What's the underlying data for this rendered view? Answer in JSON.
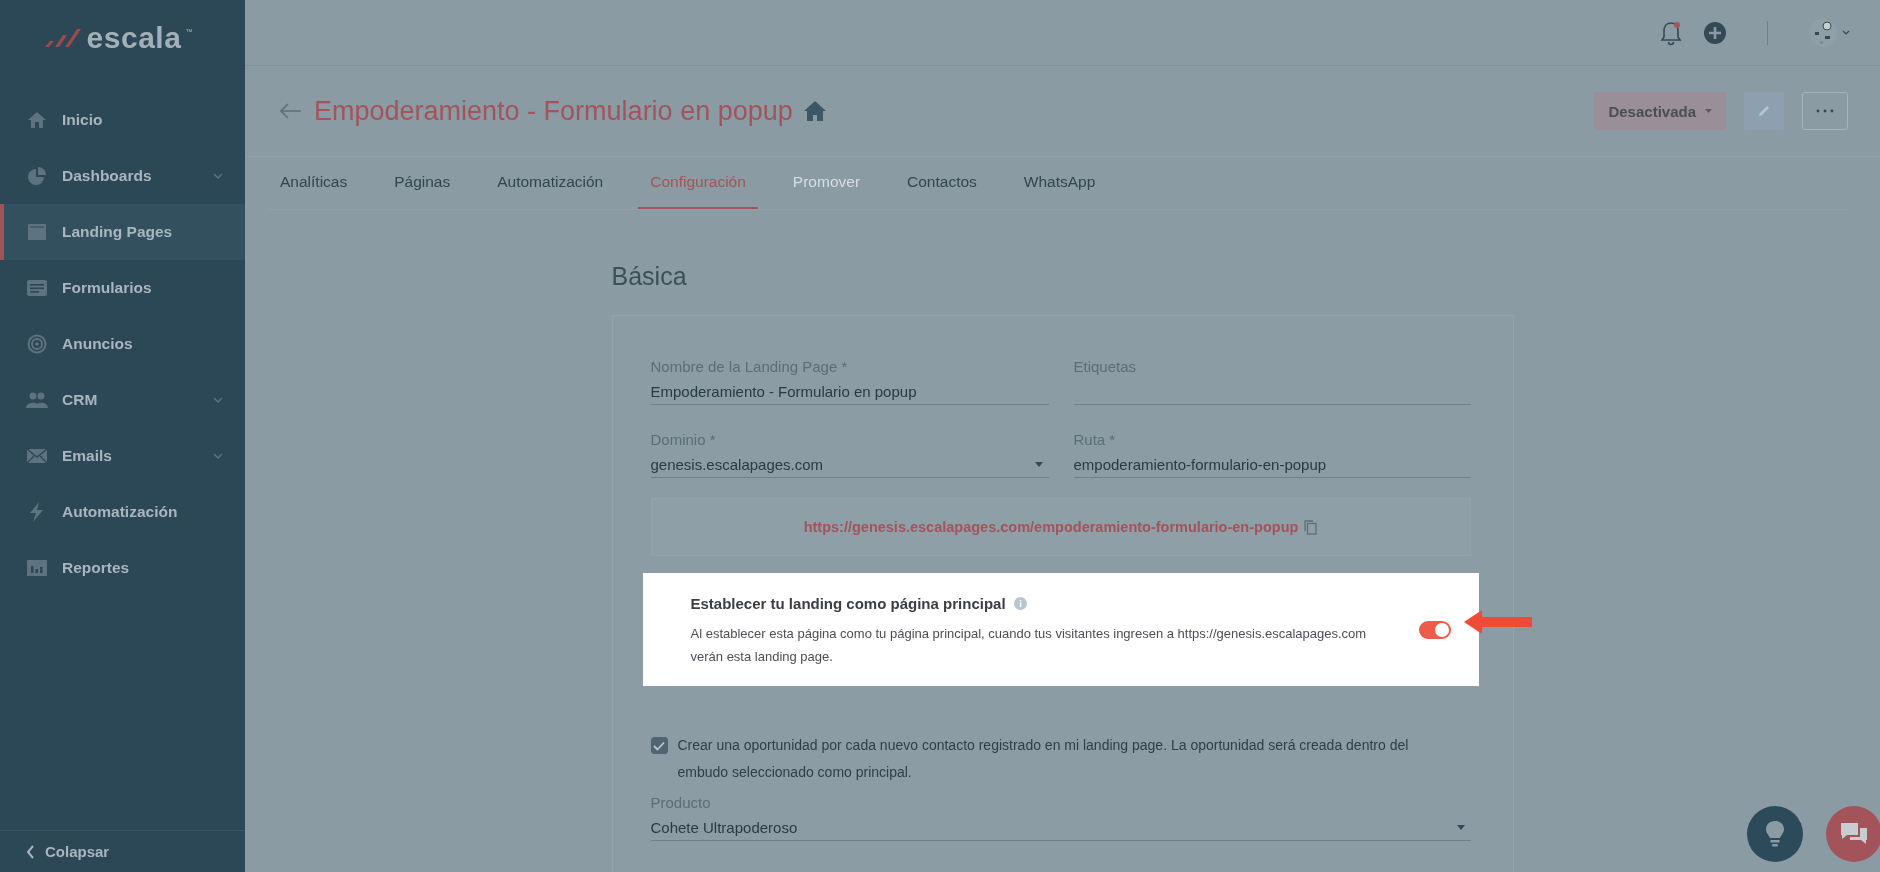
{
  "logo": {
    "text": "escala",
    "trademark": "™"
  },
  "sidebar": {
    "items": [
      {
        "label": "Inicio",
        "selected": false,
        "expandable": false
      },
      {
        "label": "Dashboards",
        "selected": false,
        "expandable": true
      },
      {
        "label": "Landing Pages",
        "selected": true,
        "expandable": false
      },
      {
        "label": "Formularios",
        "selected": false,
        "expandable": false
      },
      {
        "label": "Anuncios",
        "selected": false,
        "expandable": false
      },
      {
        "label": "CRM",
        "selected": false,
        "expandable": true
      },
      {
        "label": "Emails",
        "selected": false,
        "expandable": true
      },
      {
        "label": "Automatización",
        "selected": false,
        "expandable": false
      },
      {
        "label": "Reportes",
        "selected": false,
        "expandable": false
      }
    ],
    "collapse": "Colapsar"
  },
  "topbar": {
    "notification_unread": true
  },
  "header": {
    "title": "Empoderamiento - Formulario en popup",
    "status_button": "Desactivada"
  },
  "tabs": [
    {
      "label": "Analíticas",
      "selected": false,
      "disabled": false
    },
    {
      "label": "Páginas",
      "selected": false,
      "disabled": false
    },
    {
      "label": "Automatización",
      "selected": false,
      "disabled": false
    },
    {
      "label": "Configuración",
      "selected": true,
      "disabled": false
    },
    {
      "label": "Promover",
      "selected": false,
      "disabled": true
    },
    {
      "label": "Contactos",
      "selected": false,
      "disabled": false
    },
    {
      "label": "WhatsApp",
      "selected": false,
      "disabled": false
    }
  ],
  "section": {
    "title": "Básica"
  },
  "fields": [
    {
      "label": "Nombre de la Landing Page *",
      "value": "Empoderamiento - Formulario en popup",
      "kind": "text"
    },
    {
      "label": "Etiquetas",
      "kind": "text"
    },
    {
      "label": "Dominio *",
      "value": "genesis.escalapages.com",
      "kind": "select"
    },
    {
      "label": "Ruta *",
      "value": "empoderamiento-formulario-en-popup",
      "kind": "text"
    }
  ],
  "url": "https://genesis.escalapages.com/empoderamiento-formulario-en-popup",
  "main_page": {
    "title": "Establecer tu landing como página principal",
    "description": "Al establecer esta página como tu página principal, cuando tus visitantes ingresen a https://genesis.escalapages.com verán esta landing page.",
    "on": true
  },
  "opportunity": {
    "checked": true,
    "text": "Crear una oportunidad por cada nuevo contacto registrado en mi landing page. La oportunidad será creada dentro del embudo seleccionado como principal."
  },
  "product": {
    "label": "Producto",
    "value": "Cohete Ultrapoderoso"
  }
}
